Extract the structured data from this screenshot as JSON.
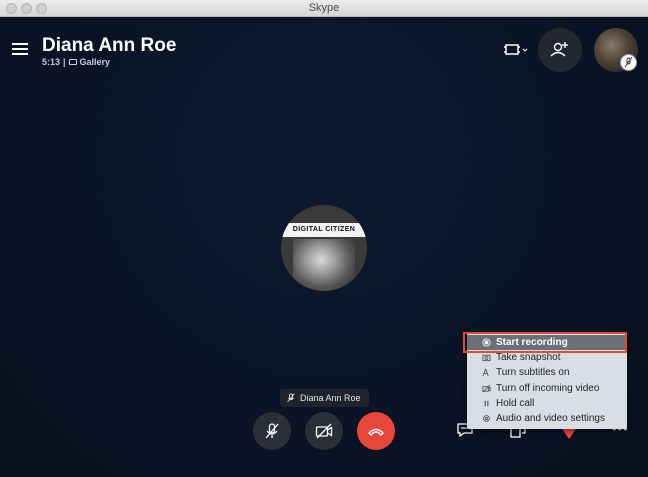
{
  "window": {
    "title": "Skype"
  },
  "call": {
    "contact_name": "Diana Ann Roe",
    "duration": "5:13",
    "separator": "|",
    "view_mode": "Gallery"
  },
  "callee": {
    "avatar_sign_text": "DIGITAL CITIZEN",
    "name_label": "Diana Ann Roe"
  },
  "controls": {
    "mute": "microphone-off-icon",
    "video": "video-off-icon",
    "end": "hang-up-icon",
    "chat": "chat-icon",
    "share": "share-screen-icon",
    "react": "heart-icon",
    "more": "•••"
  },
  "menu": {
    "items": [
      {
        "label": "Start recording",
        "icon": "record-icon"
      },
      {
        "label": "Take snapshot",
        "icon": "camera-icon"
      },
      {
        "label": "Turn subtitles on",
        "icon": "subtitles-icon"
      },
      {
        "label": "Turn off incoming video",
        "icon": "video-off-icon"
      },
      {
        "label": "Hold call",
        "icon": "pause-icon"
      },
      {
        "label": "Audio and video settings",
        "icon": "gear-icon"
      }
    ]
  },
  "colors": {
    "background": "#0b1526",
    "end_call": "#e8463b",
    "highlight": "#e8463b",
    "menu_bg": "#d9dde4",
    "menu_active": "#6b6f78"
  }
}
